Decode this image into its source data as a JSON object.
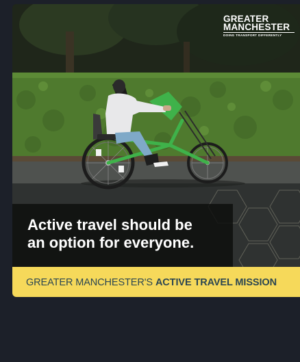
{
  "colors": {
    "page_background": "#1c2029",
    "band_background": "#f6d95a",
    "band_text": "#2b4652",
    "headline_text": "#ffffff",
    "bike_frame": "#3fb24a"
  },
  "logo": {
    "line1": "GREATER",
    "line2": "MANCHESTER",
    "tagline": "DOING TRANSPORT DIFFERENTLY"
  },
  "headline": {
    "line1": "Active travel should be",
    "line2": "an option for everyone."
  },
  "band": {
    "prefix": "GREATER MANCHESTER'S",
    "emphasis": "ACTIVE TRAVEL MISSION"
  },
  "photo": {
    "subject": "person riding a green adaptive hand-cycle along a street in front of a hedge"
  }
}
